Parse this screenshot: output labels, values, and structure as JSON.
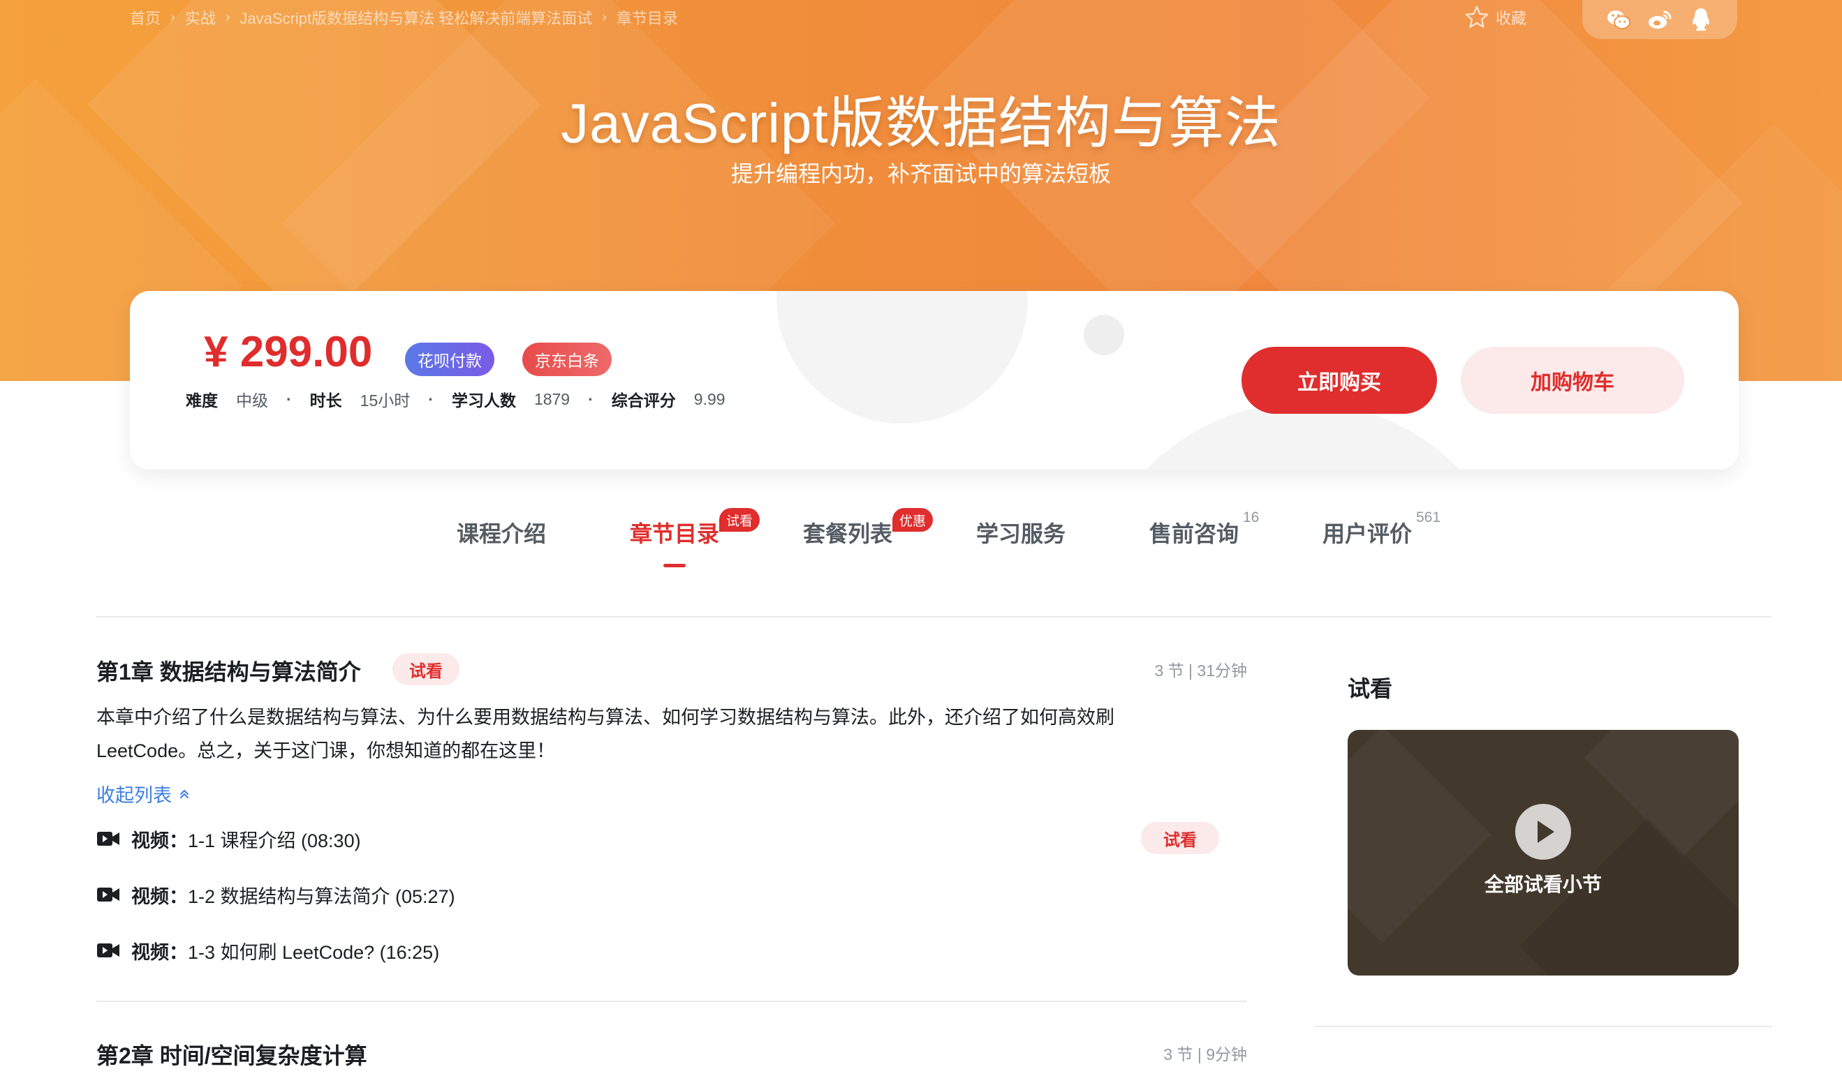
{
  "breadcrumb": {
    "items": [
      "首页",
      "实战",
      "JavaScript版数据结构与算法 轻松解决前端算法面试",
      "章节目录"
    ]
  },
  "header": {
    "collect_label": "收藏",
    "share_icons": [
      "wechat-icon",
      "weibo-icon",
      "qq-icon"
    ]
  },
  "hero": {
    "title": "JavaScript版数据结构与算法",
    "subtitle": "提升编程内功，补齐面试中的算法短板"
  },
  "price_card": {
    "price": "¥ 299.00",
    "badges": [
      "花呗付款",
      "京东白条"
    ],
    "meta": [
      {
        "key": "难度",
        "value": "中级"
      },
      {
        "key": "时长",
        "value": "15小时"
      },
      {
        "key": "学习人数",
        "value": "1879"
      },
      {
        "key": "综合评分",
        "value": "9.99"
      }
    ],
    "dot": "·",
    "buy_label": "立即购买",
    "cart_label": "加购物车"
  },
  "tabs": [
    {
      "label": "课程介绍"
    },
    {
      "label": "章节目录",
      "tag": "试看",
      "active": true
    },
    {
      "label": "套餐列表",
      "tag": "优惠"
    },
    {
      "label": "学习服务"
    },
    {
      "label": "售前咨询",
      "count": "16"
    },
    {
      "label": "用户评价",
      "count": "561"
    }
  ],
  "chapters": [
    {
      "title": "第1章  数据结构与算法简介",
      "tag": "试看",
      "stats": "3 节 | 31分钟",
      "description_line1": "本章中介绍了什么是数据结构与算法、为什么要用数据结构与算法、如何学习数据结构与算法。此外，还介绍了如何高效刷",
      "description_line2": "LeetCode。总之，关于这门课，你想知道的都在这里！",
      "collapse_label": "收起列表",
      "lessons": [
        {
          "type": "视频：",
          "name": "1-1 课程介绍 (08:30)",
          "tag": "试看"
        },
        {
          "type": "视频：",
          "name": "1-2 数据结构与算法简介 (05:27)"
        },
        {
          "type": "视频：",
          "name": "1-3 如何刷 LeetCode?  (16:25)"
        }
      ]
    },
    {
      "title": "第2章  时间/空间复杂度计算",
      "stats": "3 节 | 9分钟"
    }
  ],
  "sidebar": {
    "title": "试看",
    "video_label": "全部试看小节"
  },
  "colors": {
    "brand_red": "#e02d2d",
    "hero_orange": "#f08d3b",
    "link_blue": "#3d7fe0",
    "video_bg": "#43382c"
  }
}
